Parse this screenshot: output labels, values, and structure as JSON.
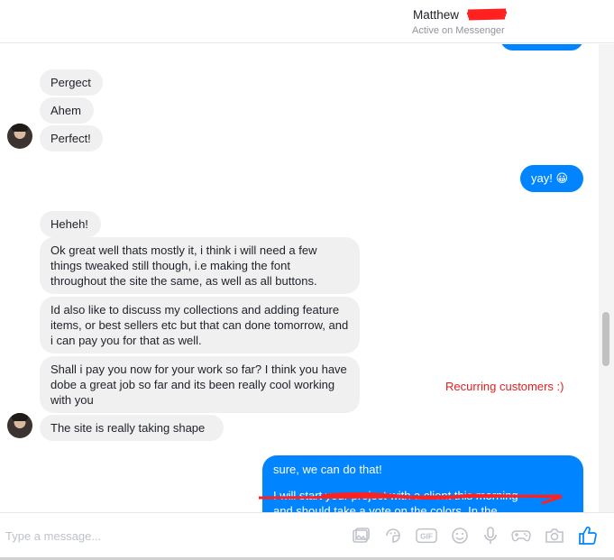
{
  "header": {
    "contact_name": "Matthew",
    "status": "Active on Messenger"
  },
  "messages": {
    "m1": "Pergect",
    "m2": "Ahem",
    "m3": "Perfect!",
    "m4": "yay! 😀",
    "m5": "Heheh!",
    "m6": "Ok great well thats mostly it, i think i will need a few things tweaked still though, i.e making the font throughout the site the same, as well as all buttons.",
    "m7": "Id also like to discuss my collections and adding feature items, or best sellers etc but that can done tomorrow, and i can pay you for that as well.",
    "m8": "Shall i pay you now for your work so far? I think you have dobe a great job so far and its been really cool working with you",
    "m9": "The site is really taking shape",
    "m10_line1": "sure, we can do that!",
    "m10_line2": "I will start your project with a client this morning",
    "m10_line3": "and should take a vote on the colors. In the"
  },
  "annotation": {
    "text": "Recurring customers :)",
    "color": "#e32020"
  },
  "composer": {
    "placeholder": "Type a message..."
  },
  "icons": [
    "image-icon",
    "sticker-icon",
    "gif-icon",
    "emoji-icon",
    "microphone-icon",
    "game-controller-icon",
    "camera-icon",
    "thumbs-up-icon"
  ],
  "colors": {
    "outgoing_bubble": "#0084ff",
    "incoming_bubble": "#f1f0f0",
    "like_icon": "#0084ff",
    "redaction": "#ff2020"
  }
}
